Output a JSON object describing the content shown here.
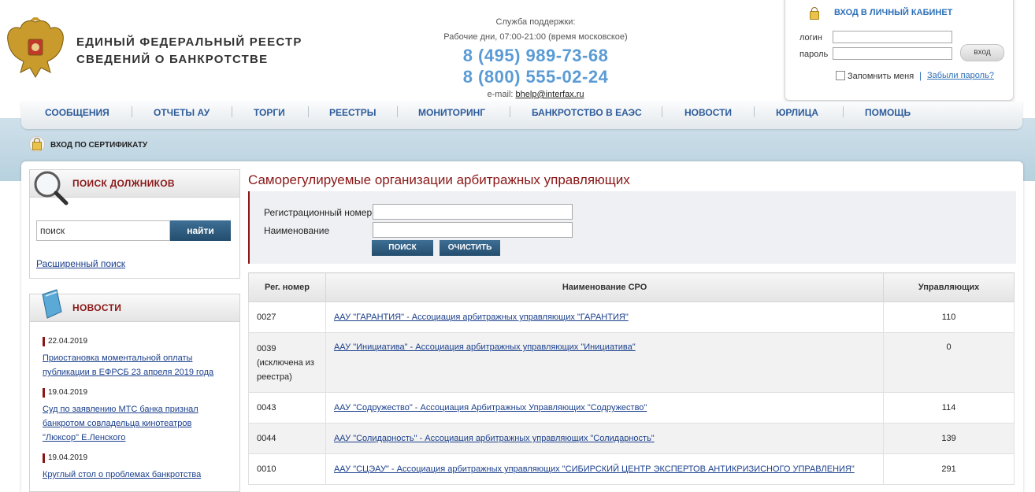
{
  "header": {
    "title_line1": "ЕДИНЫЙ ФЕДЕРАЛЬНЫЙ РЕЕСТР",
    "title_line2": "СВЕДЕНИЙ О БАНКРОТСТВЕ",
    "support_label": "Служба поддержки:",
    "support_hours": "Рабочие дни, 07:00-21:00 (время московское)",
    "phone1": "8 (495) 989-73-68",
    "phone2": "8 (800) 555-02-24",
    "email_label": "e-mail:",
    "email": "bhelp@interfax.ru"
  },
  "login": {
    "title": "ВХОД В ЛИЧНЫЙ КАБИНЕТ",
    "login_label": "логин",
    "password_label": "пароль",
    "submit": "вход",
    "remember": "Запомнить меня",
    "separator": "|",
    "forgot": "Забыли пароль?"
  },
  "nav": {
    "items": [
      "СООБЩЕНИЯ",
      "ОТЧЕТЫ АУ",
      "ТОРГИ",
      "РЕЕСТРЫ",
      "МОНИТОРИНГ",
      "БАНКРОТСТВО В ЕАЭС",
      "НОВОСТИ",
      "ЮРЛИЦА",
      "ПОМОЩЬ"
    ],
    "cert_login": "ВХОД ПО СЕРТИФИКАТУ"
  },
  "sidebar": {
    "search_title": "ПОИСК ДОЛЖНИКОВ",
    "search_value": "поиск",
    "find_button": "найти",
    "advanced_search": "Расширенный поиск",
    "news_title": "НОВОСТИ",
    "news": [
      {
        "date": "22.04.2019",
        "line1": "Приостановка моментальной оплаты",
        "line2": "публикации в ЕФРСБ 23 апреля 2019 года",
        "line3": ""
      },
      {
        "date": "19.04.2019",
        "line1": "Суд по заявлению МТС банка признал",
        "line2": "банкротом совладельца кинотеатров",
        "line3": "\"Люксор\" Е.Ленского"
      },
      {
        "date": "19.04.2019",
        "line1": "Круглый стол о проблемах банкротства",
        "line2": "",
        "line3": ""
      }
    ]
  },
  "main": {
    "title": "Саморегулируемые организации арбитражных управляющих",
    "filter": {
      "reg_label": "Регистрационный номер",
      "name_label": "Наименование",
      "search_button": "ПОИСК",
      "clear_button": "ОЧИСТИТЬ"
    },
    "table": {
      "headers": [
        "Рег. номер",
        "Наименование СРО",
        "Управляющих"
      ],
      "rows": [
        {
          "reg": "0027",
          "reg_note1": "",
          "reg_note2": "",
          "name": "ААУ \"ГАРАНТИЯ\" - Ассоциация арбитражных управляющих \"ГАРАНТИЯ\"",
          "count": "110"
        },
        {
          "reg": "0039",
          "reg_note1": "(исключена из",
          "reg_note2": "реестра)",
          "name": "ААУ \"Инициатива\" - Ассоциация арбитражных управляющих \"Инициатива\"",
          "count": "0"
        },
        {
          "reg": "0043",
          "reg_note1": "",
          "reg_note2": "",
          "name": "ААУ \"Содружество\" - Ассоциация Арбитражных Управляющих \"Содружество\"",
          "count": "114"
        },
        {
          "reg": "0044",
          "reg_note1": "",
          "reg_note2": "",
          "name": "ААУ \"Солидарность\" - Ассоциация арбитражных управляющих \"Солидарность\"",
          "count": "139"
        },
        {
          "reg": "0010",
          "reg_note1": "",
          "reg_note2": "",
          "name": "ААУ \"СЦЭАУ\" - Ассоциация арбитражных управляющих \"СИБИРСКИЙ ЦЕНТР ЭКСПЕРТОВ АНТИКРИЗИСНОГО УПРАВЛЕНИЯ\"",
          "count": "291"
        }
      ]
    }
  },
  "colors": {
    "accent_red": "#8a1616",
    "nav_blue": "#2d5b9a",
    "phone_blue": "#5b9bd5",
    "button_dark": "#244d6d"
  }
}
